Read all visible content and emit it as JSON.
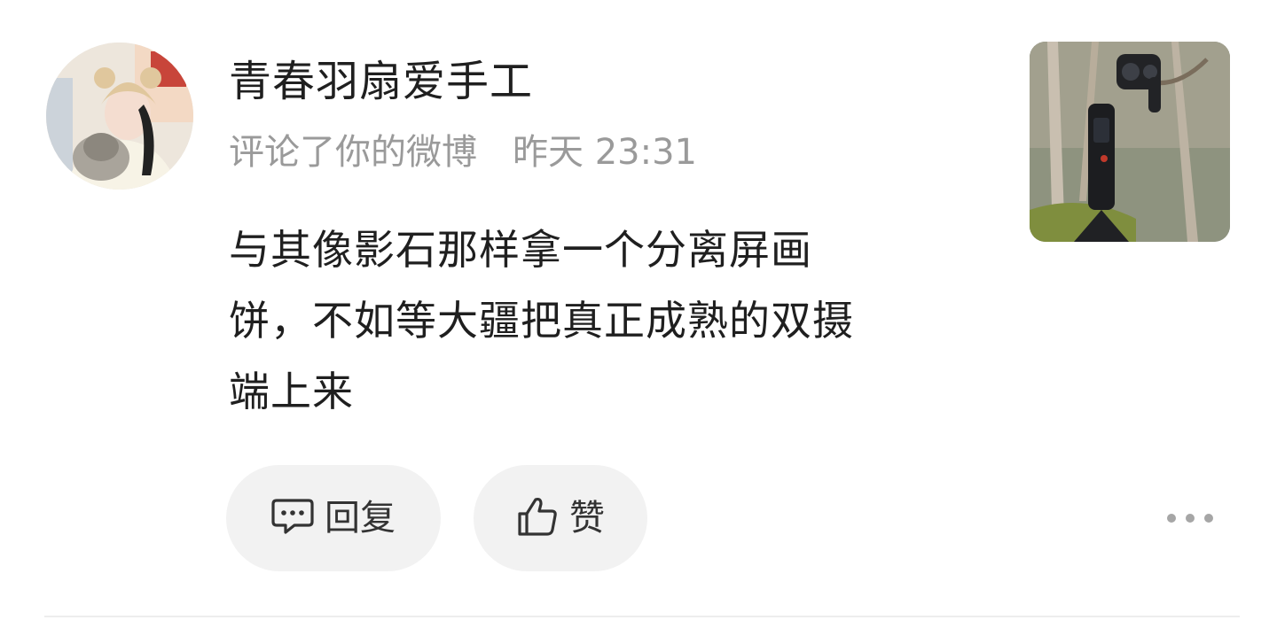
{
  "notification": {
    "user": {
      "name": "青春羽扇爱手工",
      "avatar_icon": "user-avatar"
    },
    "action": "评论了你的微博",
    "time": "昨天 23:31",
    "comment_lines": [
      "与其像影石那样拿一个分离屏画",
      "饼，不如等大疆把真正成熟的双摄",
      "端上来"
    ],
    "thumbnail_icon": "camera-photo-thumbnail"
  },
  "actions": {
    "reply_label": "回复",
    "like_label": "赞",
    "more_icon": "more-dots-icon"
  },
  "colors": {
    "text_primary": "#1f1f1f",
    "text_secondary": "#9a9a9a",
    "button_bg": "#f2f2f2"
  }
}
